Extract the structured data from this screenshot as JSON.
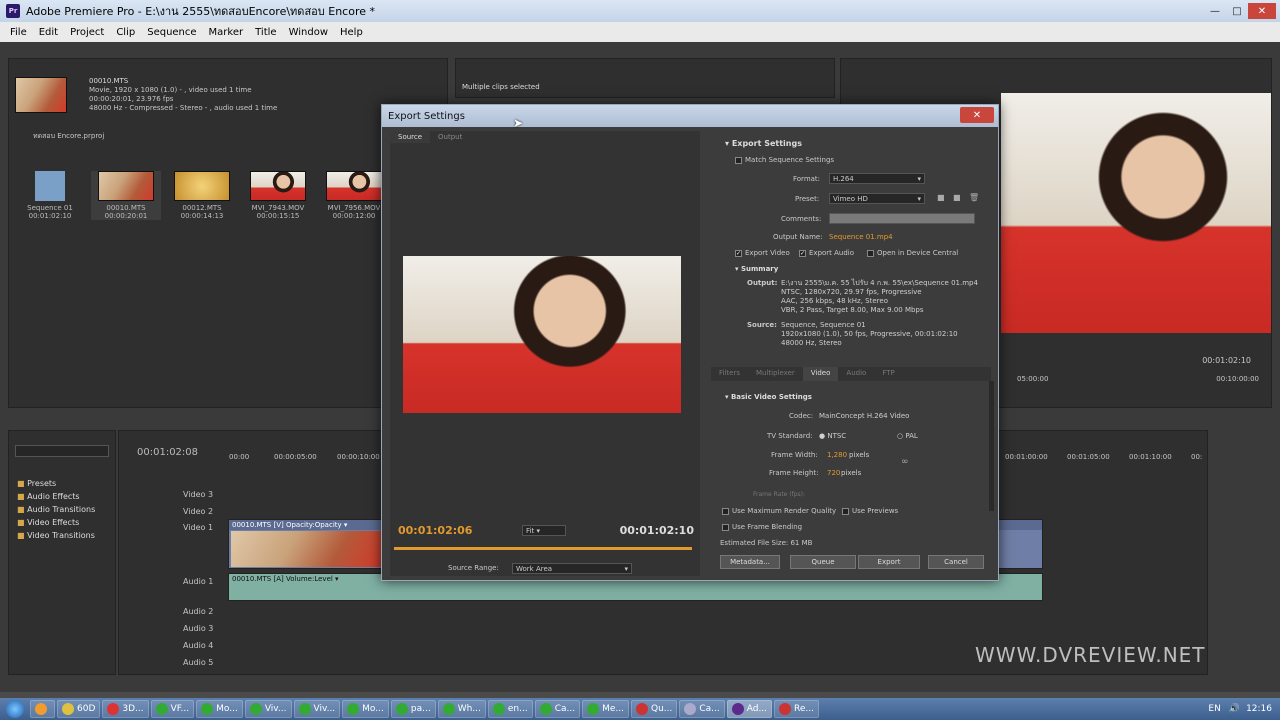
{
  "window": {
    "title": "Adobe Premiere Pro - E:\\งาน 2555\\ทดสอบEncore\\ทดสอบ Encore *",
    "app_icon": "Pr"
  },
  "menu": [
    "File",
    "Edit",
    "Project",
    "Clip",
    "Sequence",
    "Marker",
    "Title",
    "Window",
    "Help"
  ],
  "project": {
    "clip_name": "00010.MTS",
    "clip_info": [
      "Movie, 1920 x 1080 (1.0)  -  , video used 1 time",
      "00:00:20:01, 23.976 fps",
      "48000 Hz - Compressed - Stereo  -  , audio used 1 time"
    ],
    "project_file": "ทดสอบ Encore.prproj",
    "items": [
      {
        "name": "Sequence 01",
        "dur": "00:01:02:10"
      },
      {
        "name": "00010.MTS",
        "dur": "00:00:20:01"
      },
      {
        "name": "00012.MTS",
        "dur": "00:00:14:13"
      },
      {
        "name": "MVI_7943.MOV",
        "dur": "00:00:15:15"
      },
      {
        "name": "MVI_7956.MOV",
        "dur": "00:00:12:00"
      }
    ]
  },
  "source_panel": {
    "status": "Multiple clips selected"
  },
  "effects": {
    "items": [
      "Presets",
      "Audio Effects",
      "Audio Transitions",
      "Video Effects",
      "Video Transitions"
    ]
  },
  "timeline": {
    "timecode": "00:01:02:08",
    "ruler": [
      "00:00",
      "00:00:05:00",
      "00:00:10:00"
    ],
    "ruler_right": [
      "00:01:00:00",
      "00:01:05:00",
      "00:01:10:00",
      "00:"
    ],
    "tracks_video": [
      "Video 3",
      "Video 2",
      "Video 1"
    ],
    "tracks_audio": [
      "Audio 1",
      "Audio 2",
      "Audio 3",
      "Audio 4",
      "Audio 5"
    ],
    "video_clip": "00010.MTS [V]  Opacity:Opacity ▾",
    "audio_clip": "00010.MTS [A]  Volume:Level ▾"
  },
  "program": {
    "timecode_left": "05:00:00",
    "timecode_right": "00:01:02:10",
    "ruler_right": "00:10:00:00"
  },
  "dialog": {
    "title": "Export Settings",
    "tabs": [
      "Source",
      "Output"
    ],
    "timecode_current": "00:01:02:06",
    "fit": "Fit",
    "timecode_end": "00:01:02:10",
    "source_range_label": "Source Range:",
    "source_range_value": "Work Area",
    "export_settings_header": "Export Settings",
    "match_sequence": "Match Sequence Settings",
    "format_label": "Format:",
    "format_value": "H.264",
    "preset_label": "Preset:",
    "preset_value": "Vimeo HD",
    "comments_label": "Comments:",
    "output_name_label": "Output Name:",
    "output_name_value": "Sequence 01.mp4",
    "export_video": "Export Video",
    "export_audio": "Export Audio",
    "open_device_central": "Open in Device Central",
    "summary_header": "Summary",
    "output_label": "Output:",
    "output_lines": [
      "E:\\งาน 2555\\ม.ค. 55 ไปรับ 4 ก.พ. 55\\ex\\Sequence 01.mp4",
      "NTSC, 1280x720, 29.97 fps, Progressive",
      "AAC, 256 kbps, 48 kHz, Stereo",
      "VBR, 2 Pass, Target 8.00, Max 9.00 Mbps"
    ],
    "source_label": "Source:",
    "source_lines": [
      "Sequence, Sequence 01",
      "1920x1080 (1.0), 50 fps, Progressive, 00:01:02:10",
      "48000 Hz, Stereo"
    ],
    "sub_tabs": [
      "Filters",
      "Multiplexer",
      "Video",
      "Audio",
      "FTP"
    ],
    "basic_video_header": "Basic Video Settings",
    "codec_label": "Codec:",
    "codec_value": "MainConcept H.264 Video",
    "tv_standard_label": "TV Standard:",
    "ntsc": "NTSC",
    "pal": "PAL",
    "frame_width_label": "Frame Width:",
    "frame_width_value": "1,280",
    "frame_height_label": "Frame Height:",
    "frame_height_value": "720",
    "pixels": "pixels",
    "frame_rate_label": "Frame Rate (fps):",
    "use_max_render": "Use Maximum Render Quality",
    "use_previews": "Use Previews",
    "use_frame_blending": "Use Frame Blending",
    "estimated_size": "Estimated File Size: 61 MB",
    "btn_metadata": "Metadata...",
    "btn_queue": "Queue",
    "btn_export": "Export",
    "btn_cancel": "Cancel"
  },
  "watermark": "WWW.DVREVIEW.NET",
  "taskbar": {
    "items": [
      "60D",
      "3D...",
      "VF...",
      "Mo...",
      "Viv...",
      "Viv...",
      "Mo...",
      "pa...",
      "Wh...",
      "en...",
      "Ca...",
      "Me...",
      "Qu...",
      "Ca...",
      "Ad...",
      "Re..."
    ],
    "lang": "EN",
    "clock": "12:16"
  },
  "colors": {
    "accent_orange": "#e29a2e",
    "dialog_bg": "#3c3c3c",
    "panel_bg": "#2f2f2f"
  }
}
